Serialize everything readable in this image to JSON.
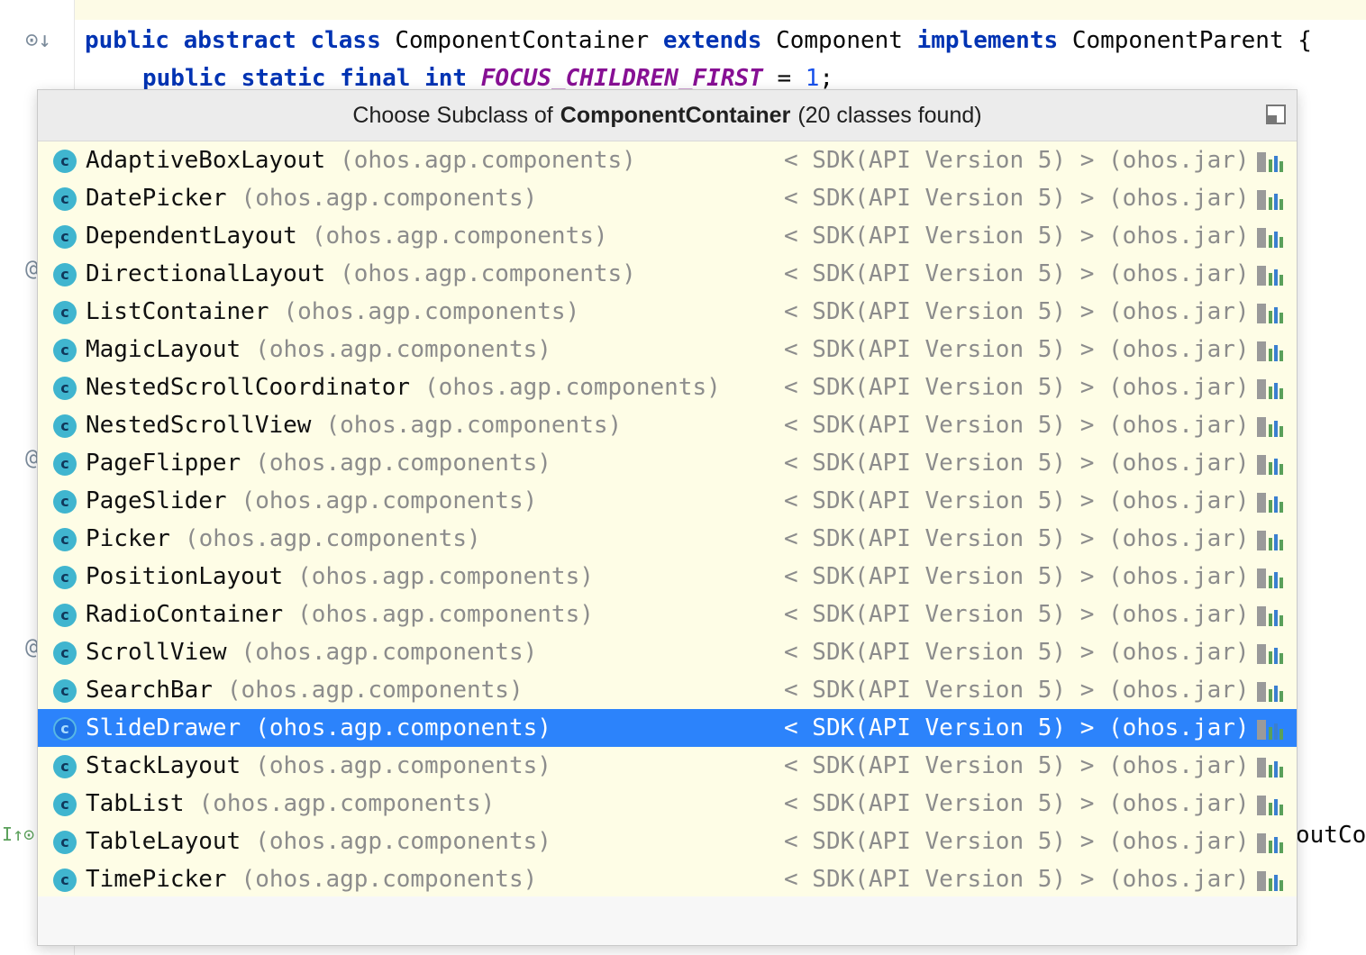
{
  "editor": {
    "line1": {
      "k1": "public",
      "k2": "abstract",
      "k3": "class",
      "name": "ComponentContainer",
      "k4": "extends",
      "parent": "Component",
      "k5": "implements",
      "iface": "ComponentParent",
      "brace": "{"
    },
    "line2": {
      "k1": "public",
      "k2": "static",
      "k3": "final",
      "k4": "int",
      "const": "FOCUS_CHILDREN_FIRST",
      "eq": "=",
      "value": "1",
      "semi": ";"
    },
    "right_fragment": "outCo"
  },
  "popup": {
    "title_prefix": "Choose Subclass of",
    "title_class": "ComponentContainer",
    "title_suffix": "(20 classes found)",
    "icon_letter": "c",
    "selected_index": 15,
    "items": [
      {
        "name": "AdaptiveBoxLayout",
        "package": "(ohos.agp.components)",
        "sdk": "< SDK(API Version 5) > (ohos.jar)"
      },
      {
        "name": "DatePicker",
        "package": "(ohos.agp.components)",
        "sdk": "< SDK(API Version 5) > (ohos.jar)"
      },
      {
        "name": "DependentLayout",
        "package": "(ohos.agp.components)",
        "sdk": "< SDK(API Version 5) > (ohos.jar)"
      },
      {
        "name": "DirectionalLayout",
        "package": "(ohos.agp.components)",
        "sdk": "< SDK(API Version 5) > (ohos.jar)"
      },
      {
        "name": "ListContainer",
        "package": "(ohos.agp.components)",
        "sdk": "< SDK(API Version 5) > (ohos.jar)"
      },
      {
        "name": "MagicLayout",
        "package": "(ohos.agp.components)",
        "sdk": "< SDK(API Version 5) > (ohos.jar)"
      },
      {
        "name": "NestedScrollCoordinator",
        "package": "(ohos.agp.components)",
        "sdk": "< SDK(API Version 5) > (ohos.jar)"
      },
      {
        "name": "NestedScrollView",
        "package": "(ohos.agp.components)",
        "sdk": "< SDK(API Version 5) > (ohos.jar)"
      },
      {
        "name": "PageFlipper",
        "package": "(ohos.agp.components)",
        "sdk": "< SDK(API Version 5) > (ohos.jar)"
      },
      {
        "name": "PageSlider",
        "package": "(ohos.agp.components)",
        "sdk": "< SDK(API Version 5) > (ohos.jar)"
      },
      {
        "name": "Picker",
        "package": "(ohos.agp.components)",
        "sdk": "< SDK(API Version 5) > (ohos.jar)"
      },
      {
        "name": "PositionLayout",
        "package": "(ohos.agp.components)",
        "sdk": "< SDK(API Version 5) > (ohos.jar)"
      },
      {
        "name": "RadioContainer",
        "package": "(ohos.agp.components)",
        "sdk": "< SDK(API Version 5) > (ohos.jar)"
      },
      {
        "name": "ScrollView",
        "package": "(ohos.agp.components)",
        "sdk": "< SDK(API Version 5) > (ohos.jar)"
      },
      {
        "name": "SearchBar",
        "package": "(ohos.agp.components)",
        "sdk": "< SDK(API Version 5) > (ohos.jar)"
      },
      {
        "name": "SlideDrawer",
        "package": "(ohos.agp.components)",
        "sdk": "< SDK(API Version 5) > (ohos.jar)"
      },
      {
        "name": "StackLayout",
        "package": "(ohos.agp.components)",
        "sdk": "< SDK(API Version 5) > (ohos.jar)"
      },
      {
        "name": "TabList",
        "package": "(ohos.agp.components)",
        "sdk": "< SDK(API Version 5) > (ohos.jar)"
      },
      {
        "name": "TableLayout",
        "package": "(ohos.agp.components)",
        "sdk": "< SDK(API Version 5) > (ohos.jar)"
      },
      {
        "name": "TimePicker",
        "package": "(ohos.agp.components)",
        "sdk": "< SDK(API Version 5) > (ohos.jar)"
      }
    ]
  },
  "colors": {
    "selection": "#2c83fb",
    "list_bg": "#fefde6",
    "keyword": "#0033b3",
    "constant": "#871094",
    "class_icon": "#40b5cf"
  }
}
